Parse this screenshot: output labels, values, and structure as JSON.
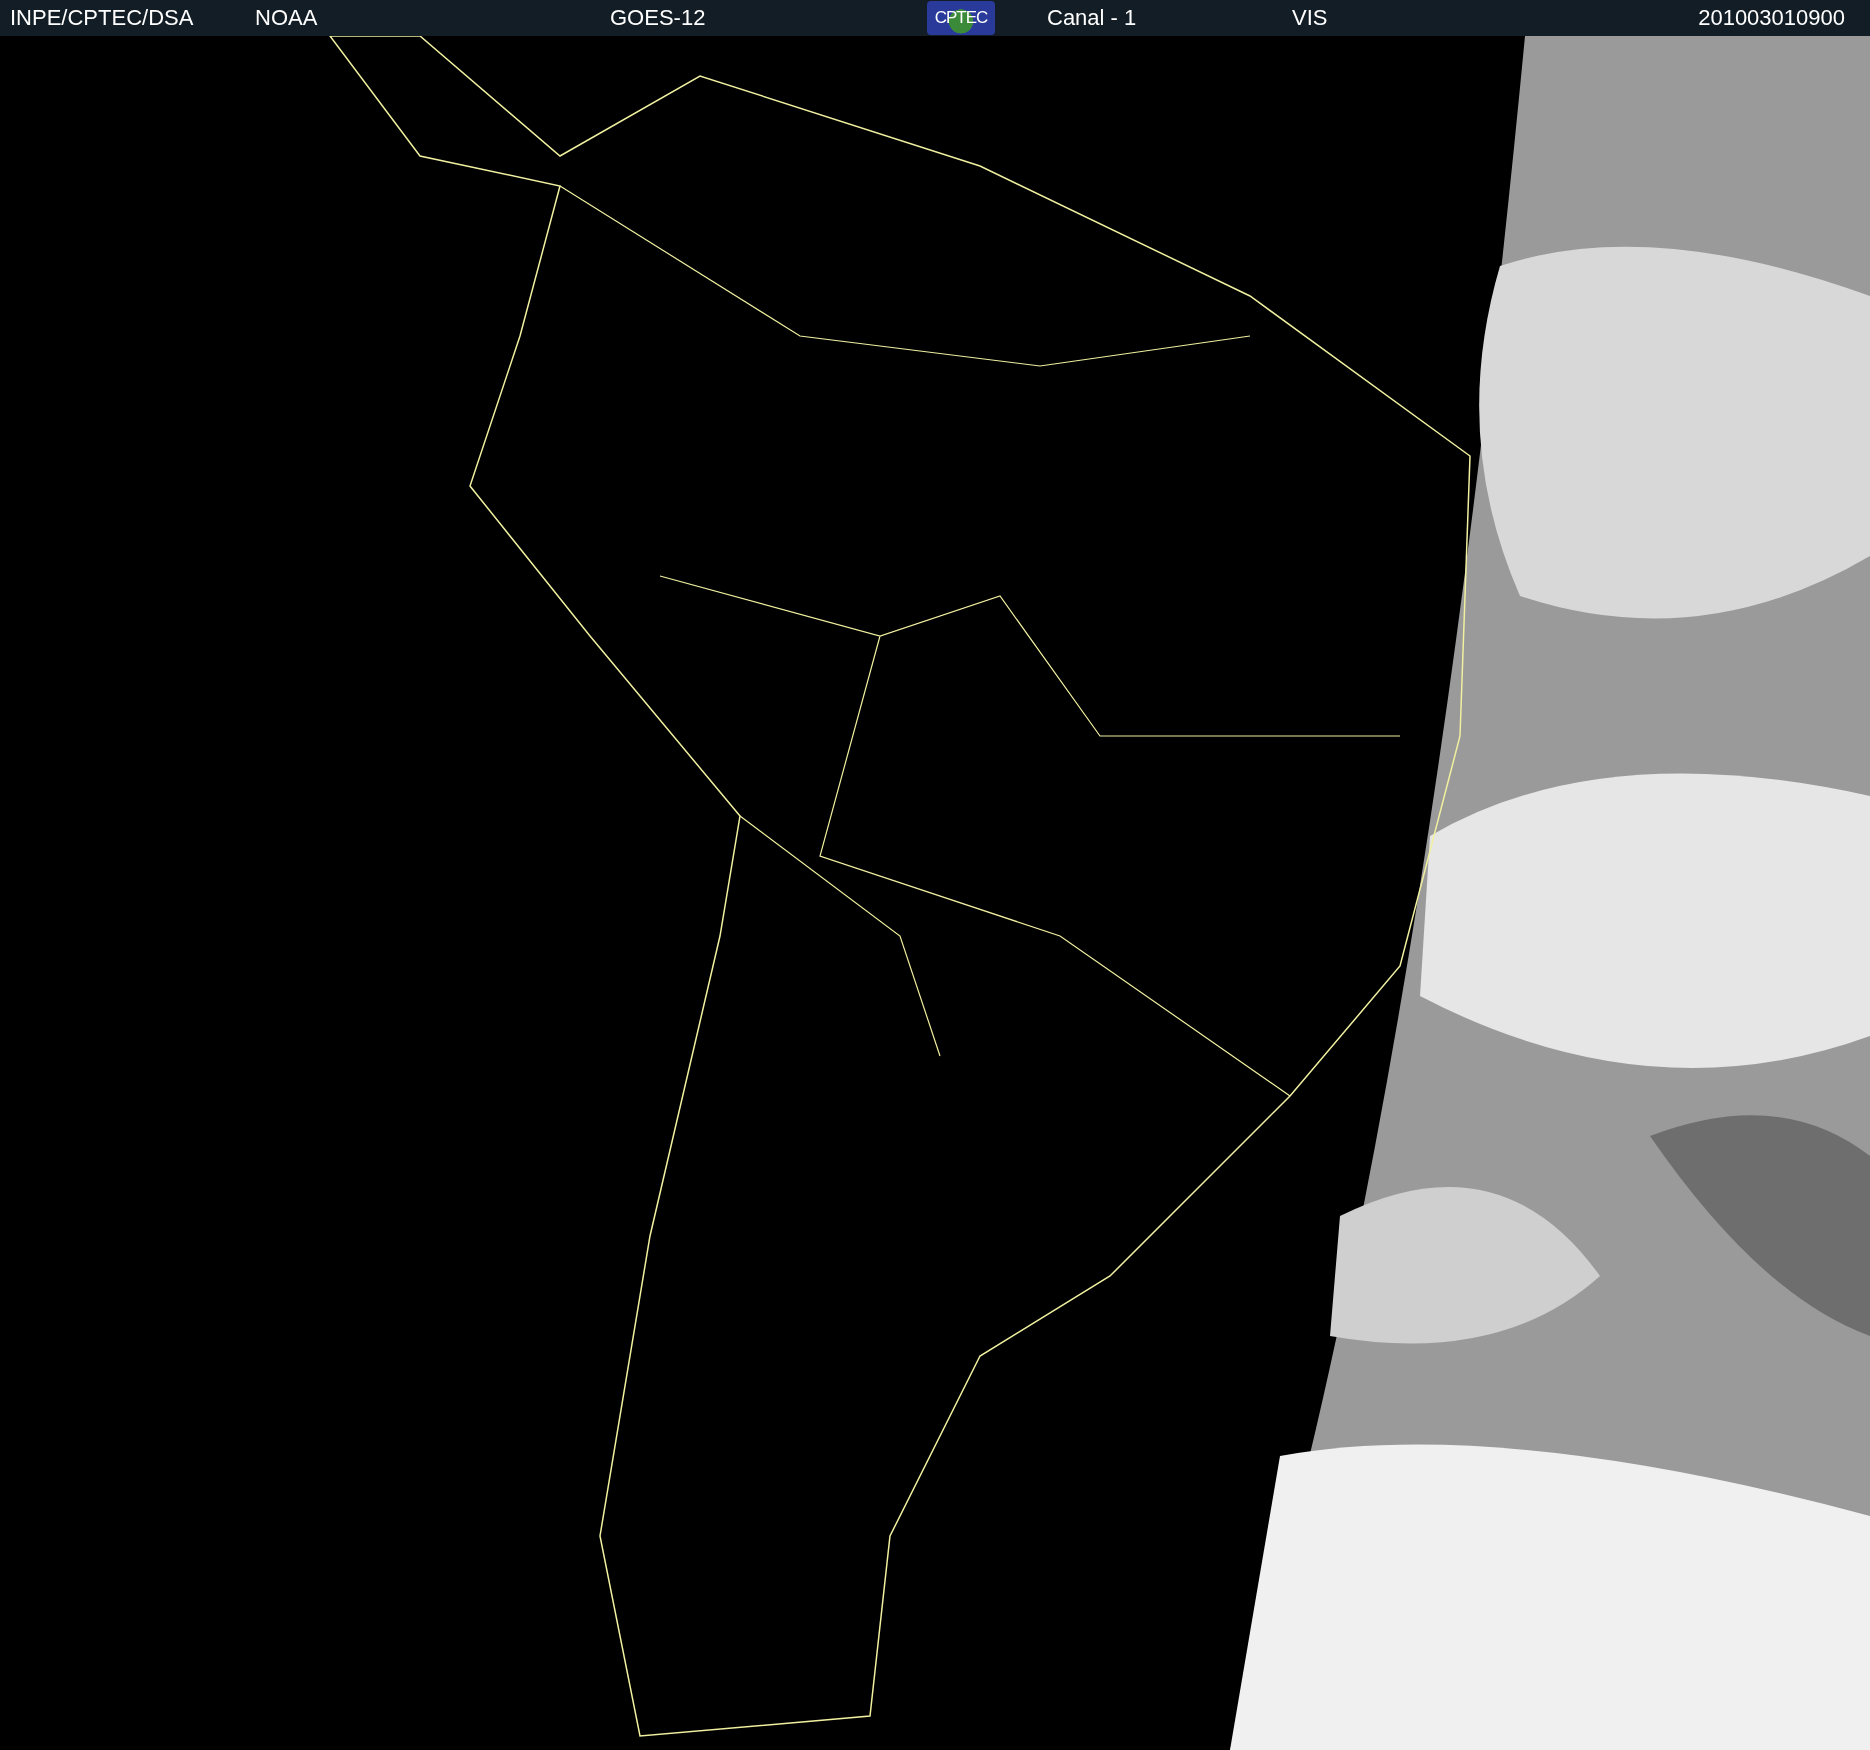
{
  "header": {
    "items": [
      {
        "kind": "text",
        "text": "INPE/CPTEC/DSA"
      },
      {
        "kind": "text",
        "text": "NOAA"
      },
      {
        "kind": "text",
        "text": "GOES-12"
      },
      {
        "kind": "logo",
        "text": "CPTEC"
      },
      {
        "kind": "text",
        "text": "Canal - 1"
      },
      {
        "kind": "text",
        "text": "VIS"
      },
      {
        "kind": "text",
        "text": "201003010900"
      }
    ]
  }
}
